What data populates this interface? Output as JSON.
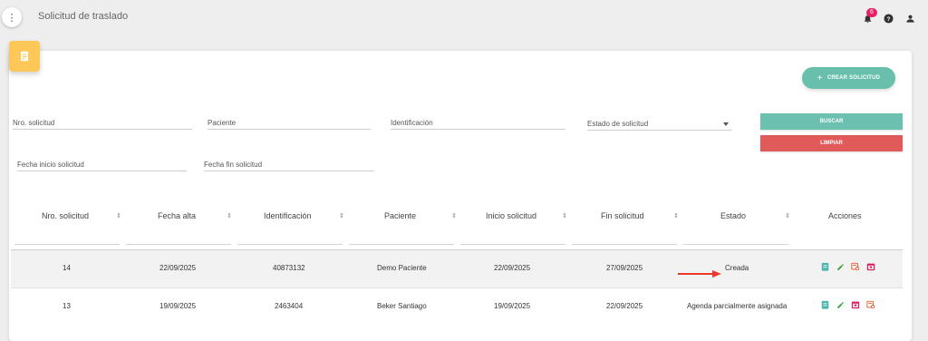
{
  "header": {
    "title": "Solicitud de traslado",
    "notification_count": "6",
    "icons": [
      "menu-dots-icon",
      "bell-icon",
      "help-icon",
      "user-icon"
    ]
  },
  "actions": {
    "create_label": "CREAR SOLICITUD",
    "search_label": "BUSCAR",
    "clear_label": "LIMPIAR"
  },
  "filters": {
    "nro_solicitud": "Nro. solicitud",
    "paciente": "Paciente",
    "identificacion": "Identificación",
    "estado": "Estado de solicitud",
    "fecha_inicio": "Fecha inicio solicitud",
    "fecha_fin": "Fecha fin solicitud"
  },
  "table": {
    "columns": [
      "Nro. solicitud",
      "Fecha alta",
      "Identificación",
      "Paciente",
      "Inicio solicitud",
      "Fin solicitud",
      "Estado",
      "Acciones"
    ],
    "rows": [
      {
        "nro": "14",
        "fecha_alta": "22/09/2025",
        "identificacion": "40873132",
        "paciente": "Demo Paciente",
        "inicio": "22/09/2025",
        "fin": "27/09/2025",
        "estado": "Creada"
      },
      {
        "nro": "13",
        "fecha_alta": "19/09/2025",
        "identificacion": "2463404",
        "paciente": "Beker Santiago",
        "inicio": "19/09/2025",
        "fin": "22/09/2025",
        "estado": "Agenda parcialmente asignada"
      }
    ]
  },
  "colors": {
    "accent_teal": "#68c0ac",
    "danger_red": "#e05a5a",
    "card_tab_yellow": "#fdc857",
    "badge_pink": "#e91e63",
    "annotation_arrow": "#e8392f"
  }
}
